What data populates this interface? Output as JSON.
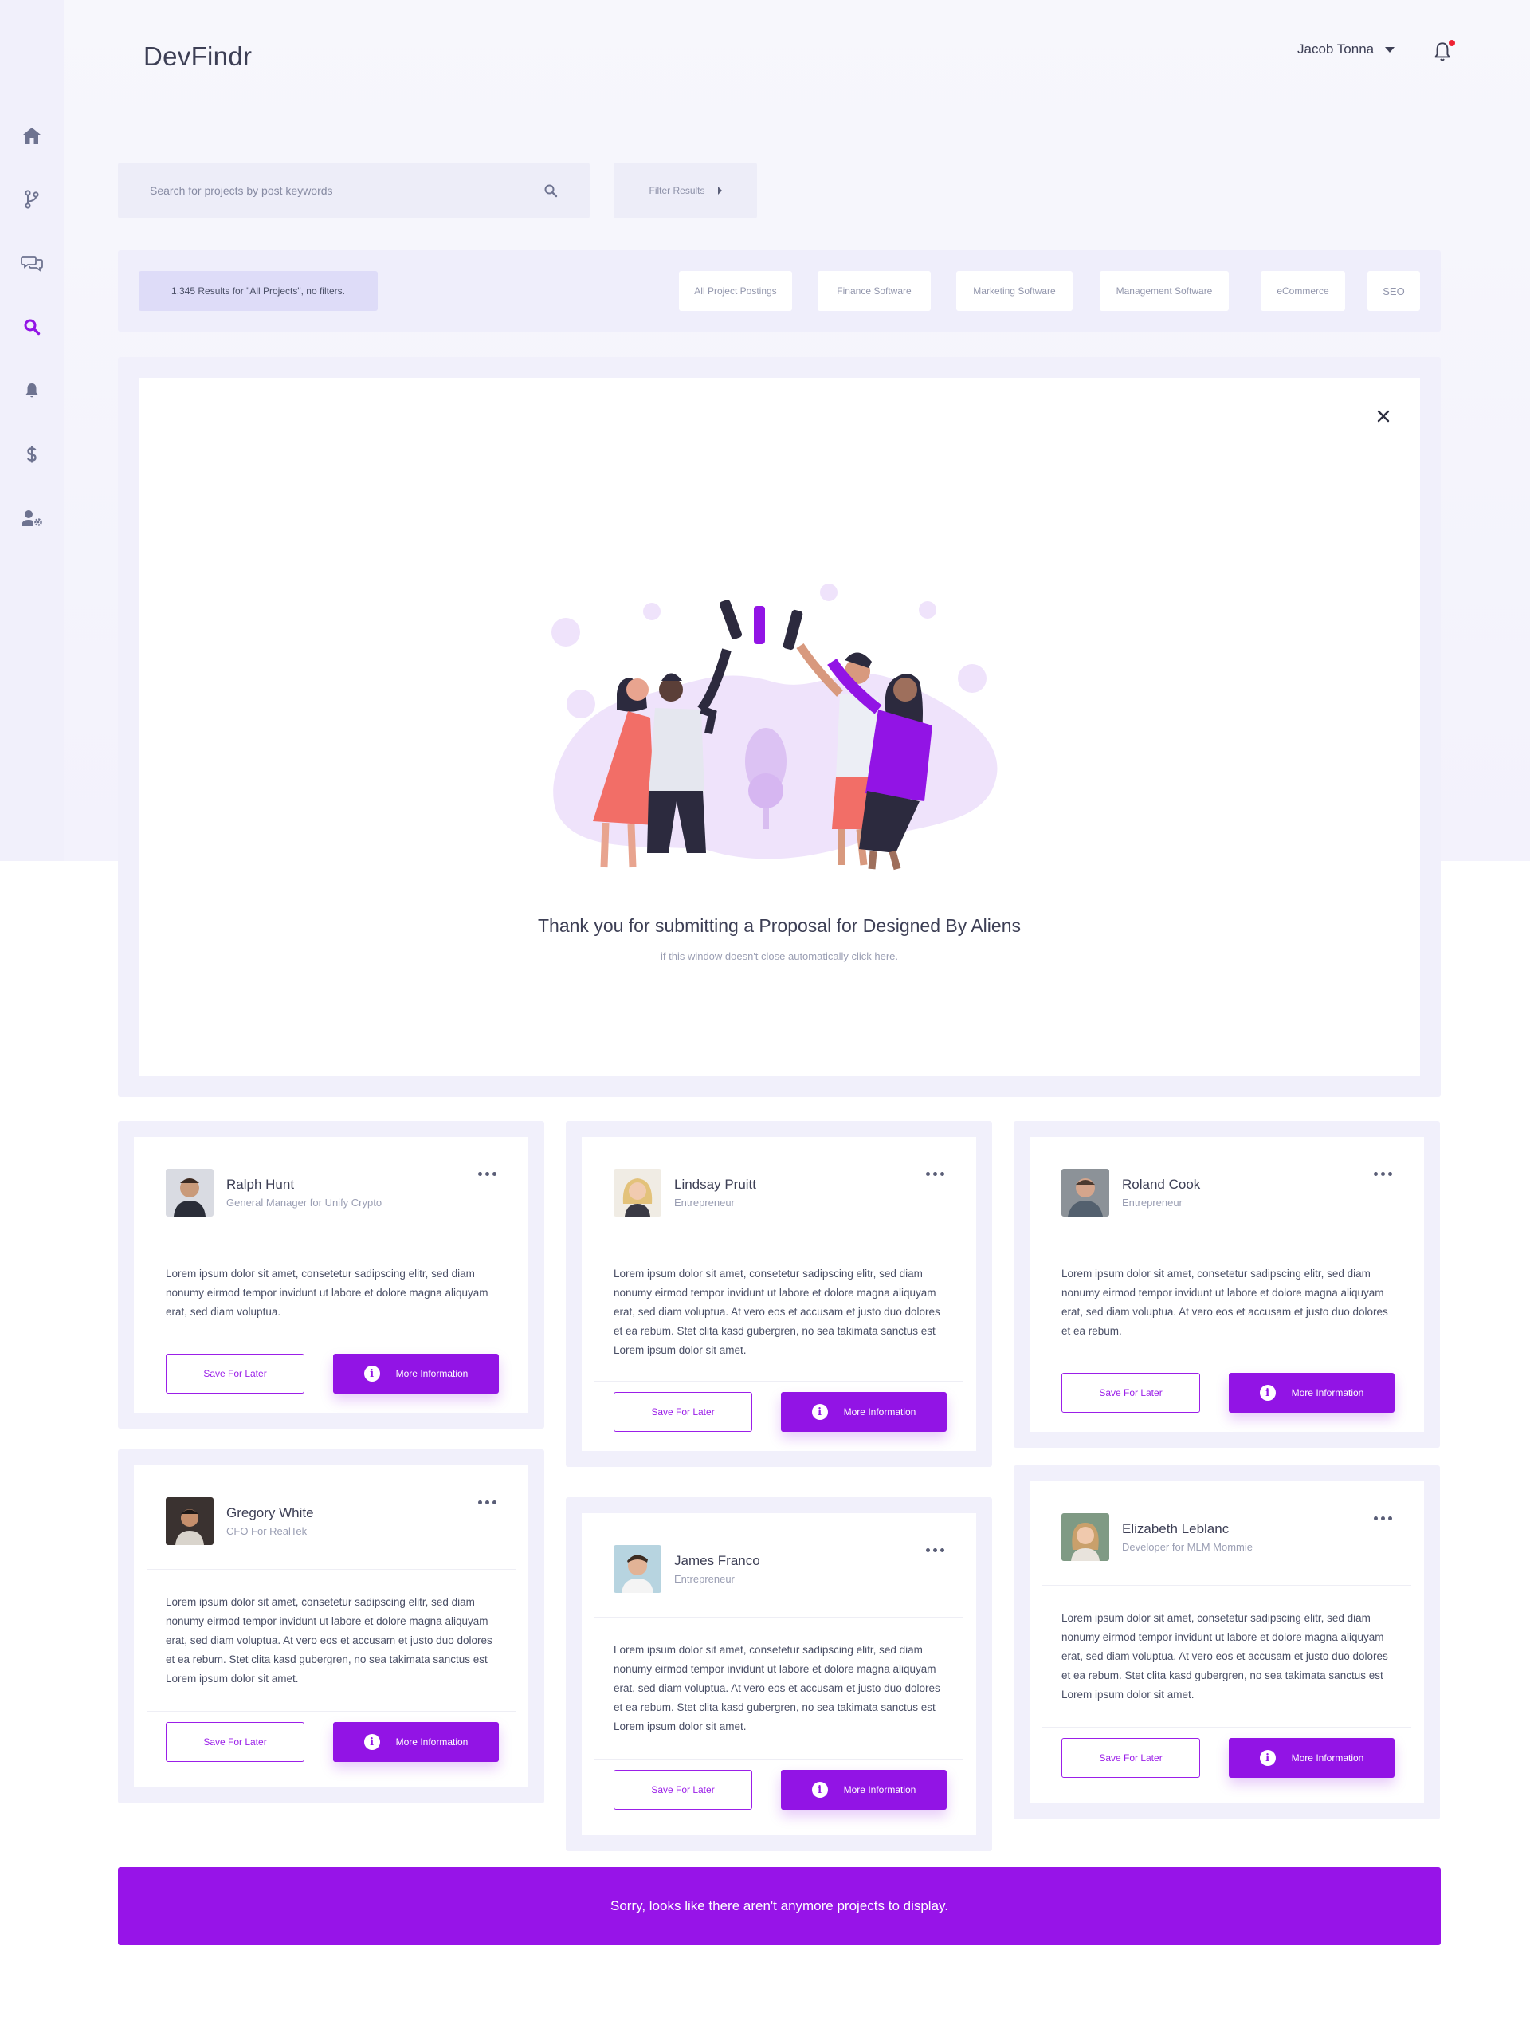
{
  "app": {
    "title": "DevFindr"
  },
  "header": {
    "user_name": "Jacob Tonna"
  },
  "sidebar": {
    "items": [
      {
        "icon": "home-icon",
        "active": false
      },
      {
        "icon": "git-branch-icon",
        "active": false
      },
      {
        "icon": "chat-icon",
        "active": false
      },
      {
        "icon": "search-icon",
        "active": true
      },
      {
        "icon": "bell-icon",
        "active": false
      },
      {
        "icon": "dollar-icon",
        "active": false
      },
      {
        "icon": "user-settings-icon",
        "active": false
      }
    ]
  },
  "search": {
    "placeholder": "Search for projects by post keywords",
    "value": ""
  },
  "filter": {
    "label": "Filter Results"
  },
  "results": {
    "summary": "1,345 Results for \"All Projects\", no filters."
  },
  "categories": [
    "All Project Postings",
    "Finance Software",
    "Marketing Software",
    "Management Software",
    "eCommerce",
    "SEO"
  ],
  "modal": {
    "message": "Thank you for submitting a Proposal for Designed By Aliens",
    "subnote": "if this window doesn't close automatically click here."
  },
  "colors": {
    "accent": "#9214e5",
    "accent_light": "#dedcf8",
    "panel_bg": "#f1f0fb",
    "banner": "#9714e8"
  },
  "cards": [
    {
      "name": "Ralph Hunt",
      "title": "General Manager for Unify Crypto",
      "body": "Lorem ipsum dolor sit amet, consetetur sadipscing elitr, sed diam nonumy eirmod tempor invidunt ut labore et dolore magna aliquyam erat, sed diam voluptua.",
      "save_label": "Save For Later",
      "more_label": "More Information"
    },
    {
      "name": "Lindsay Pruitt",
      "title": "Entrepreneur",
      "body": "Lorem ipsum dolor sit amet, consetetur sadipscing elitr, sed diam nonumy eirmod tempor invidunt ut labore et dolore magna aliquyam erat, sed diam voluptua. At vero eos et accusam et justo duo dolores et ea rebum. Stet clita kasd gubergren, no sea takimata sanctus est Lorem ipsum dolor sit amet.",
      "save_label": "Save For Later",
      "more_label": "More Information"
    },
    {
      "name": "Roland Cook",
      "title": "Entrepreneur",
      "body": "Lorem ipsum dolor sit amet, consetetur sadipscing elitr, sed diam nonumy eirmod tempor invidunt ut labore et dolore magna aliquyam erat, sed diam voluptua. At vero eos et accusam et justo duo dolores et ea rebum.",
      "save_label": "Save For Later",
      "more_label": "More Information"
    },
    {
      "name": "Gregory White",
      "title": "CFO For RealTek",
      "body": "Lorem ipsum dolor sit amet, consetetur sadipscing elitr, sed diam nonumy eirmod tempor invidunt ut labore et dolore magna aliquyam erat, sed diam voluptua. At vero eos et accusam et justo duo dolores et ea rebum. Stet clita kasd gubergren, no sea takimata sanctus est Lorem ipsum dolor sit amet.",
      "save_label": "Save For Later",
      "more_label": "More Information"
    },
    {
      "name": "James Franco",
      "title": "Entrepreneur",
      "body": "Lorem ipsum dolor sit amet, consetetur sadipscing elitr, sed diam nonumy eirmod tempor invidunt ut labore et dolore magna aliquyam erat, sed diam voluptua. At vero eos et accusam et justo duo dolores et ea rebum. Stet clita kasd gubergren, no sea takimata sanctus est Lorem ipsum dolor sit amet.",
      "save_label": "Save For Later",
      "more_label": "More Information"
    },
    {
      "name": "Elizabeth Leblanc",
      "title": "Developer for MLM Mommie",
      "body": "Lorem ipsum dolor sit amet, consetetur sadipscing elitr, sed diam nonumy eirmod tempor invidunt ut labore et dolore magna aliquyam erat, sed diam voluptua. At vero eos et accusam et justo duo dolores et ea rebum. Stet clita kasd gubergren, no sea takimata sanctus est Lorem ipsum dolor sit amet.",
      "save_label": "Save For Later",
      "more_label": "More Information"
    }
  ],
  "banner": {
    "message": "Sorry, looks like there aren't anymore projects to display."
  }
}
